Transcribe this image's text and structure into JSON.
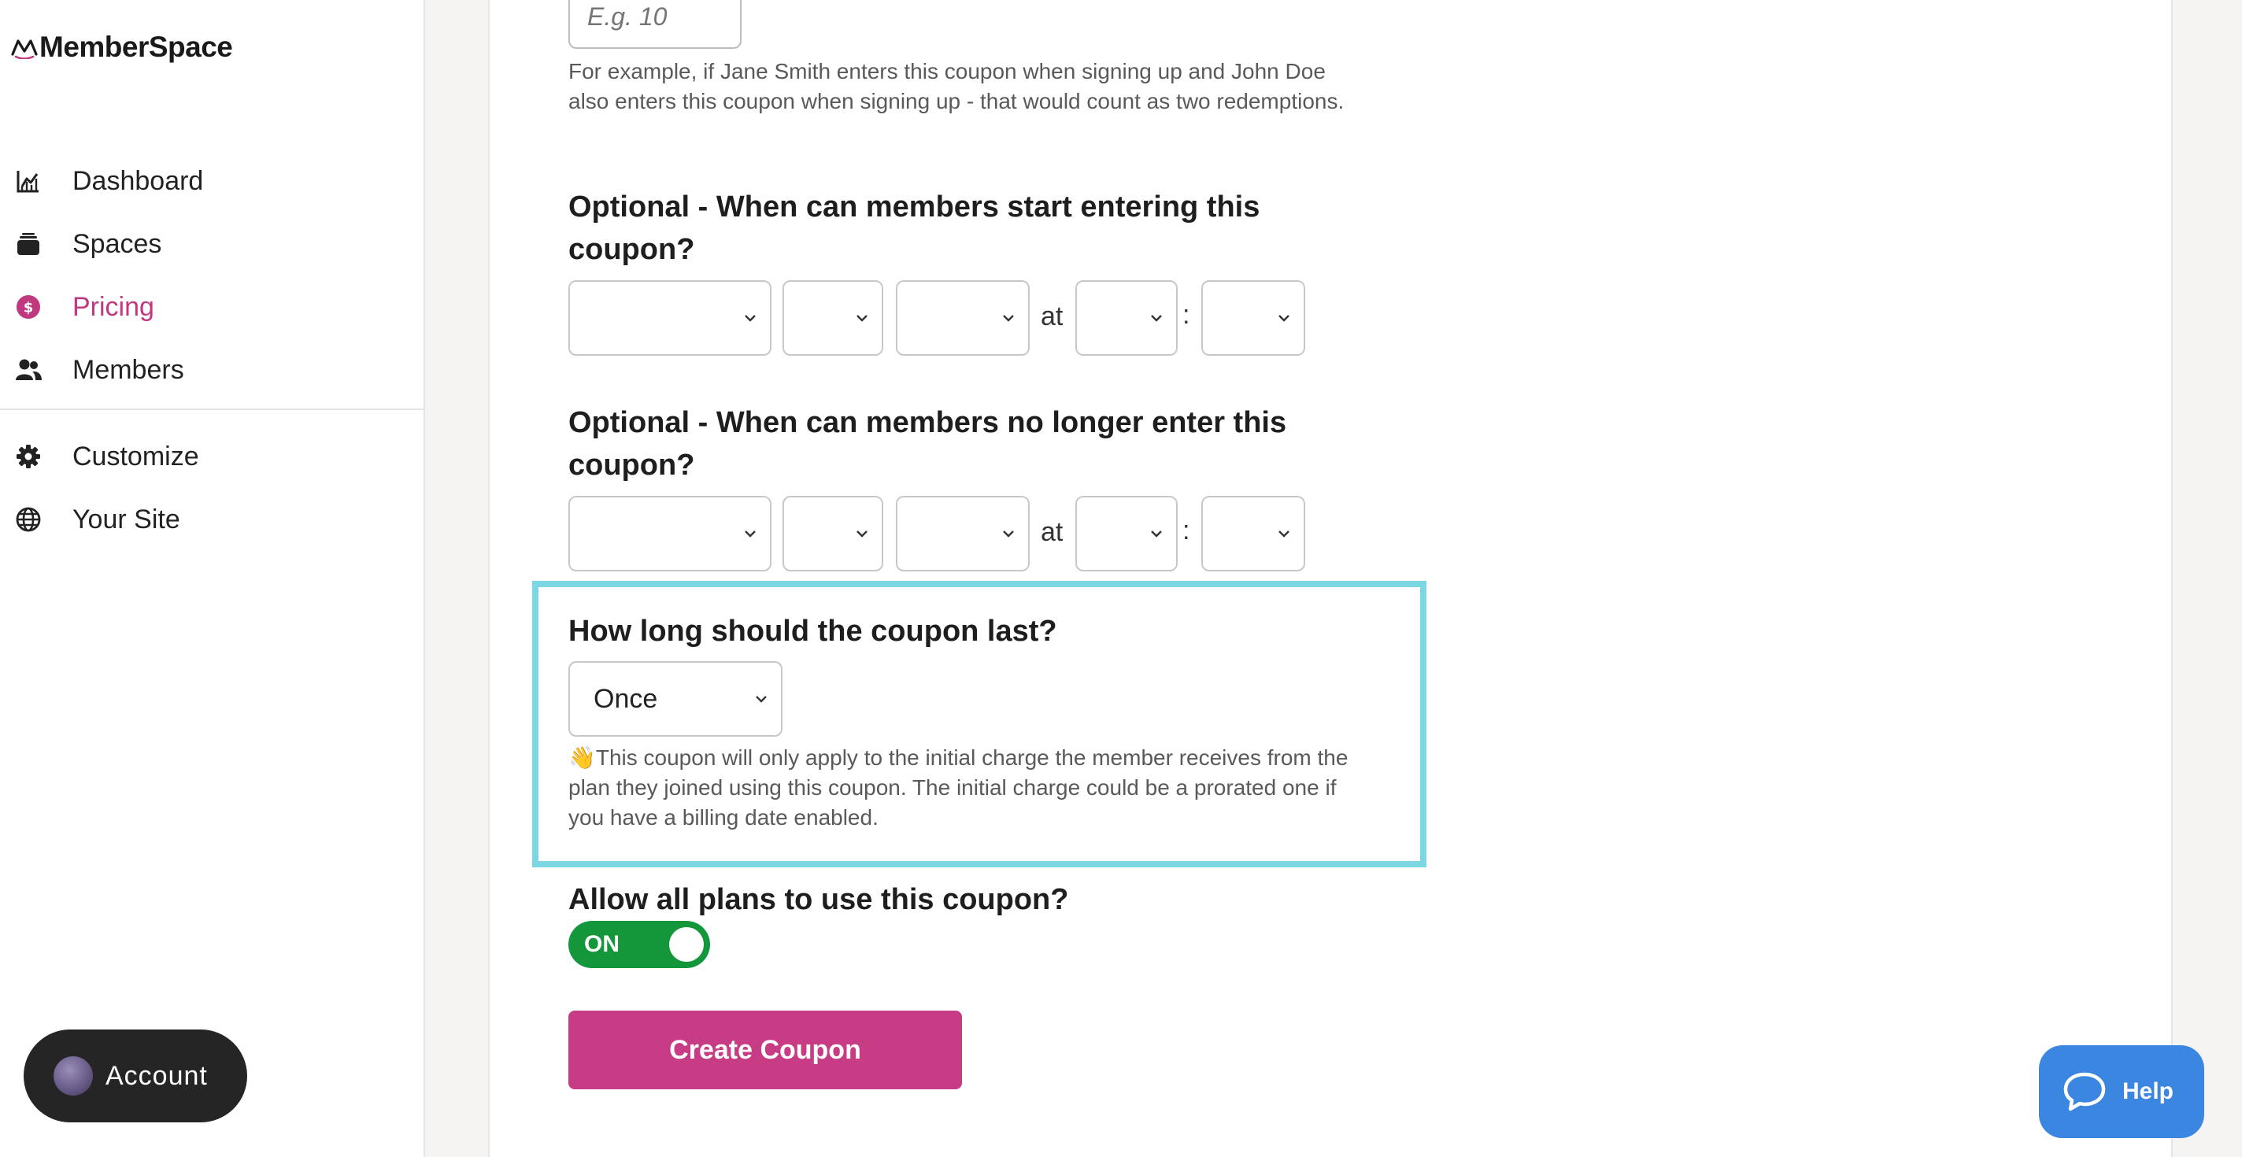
{
  "brand": {
    "name": "MemberSpace",
    "accent": "#c0397f"
  },
  "sidebar": {
    "items": [
      {
        "label": "Dashboard",
        "icon": "chart-icon"
      },
      {
        "label": "Spaces",
        "icon": "stack-icon"
      },
      {
        "label": "Pricing",
        "icon": "dollar-icon",
        "active": true
      },
      {
        "label": "Members",
        "icon": "users-icon"
      }
    ],
    "secondary_items": [
      {
        "label": "Customize",
        "icon": "gear-icon"
      },
      {
        "label": "Your Site",
        "icon": "globe-icon"
      }
    ],
    "account_label": "Account"
  },
  "form": {
    "redemptions_placeholder": "E.g. 10",
    "redemptions_help": "For example, if Jane Smith enters this coupon when signing up and John Doe also enters this coupon when signing up - that would count as two redemptions.",
    "start_heading": "Optional - When can members start entering this coupon?",
    "end_heading": "Optional - When can members no longer enter this coupon?",
    "at_label": "at",
    "colon_label": ":",
    "duration_heading": "How long should the coupon last?",
    "duration_value": "Once",
    "duration_help": "👋This coupon will only apply to the initial charge the member receives from the plan they joined using this coupon. The initial charge could be a prorated one if you have a billing date enabled.",
    "allow_plans_heading": "Allow all plans to use this coupon?",
    "toggle_label": "ON",
    "create_label": "Create Coupon"
  },
  "help_widget": {
    "label": "Help"
  },
  "colors": {
    "toggle_on": "#14973a",
    "button_primary": "#c83b85",
    "highlight": "#7dd7e2",
    "help_button": "#3b86e0"
  }
}
